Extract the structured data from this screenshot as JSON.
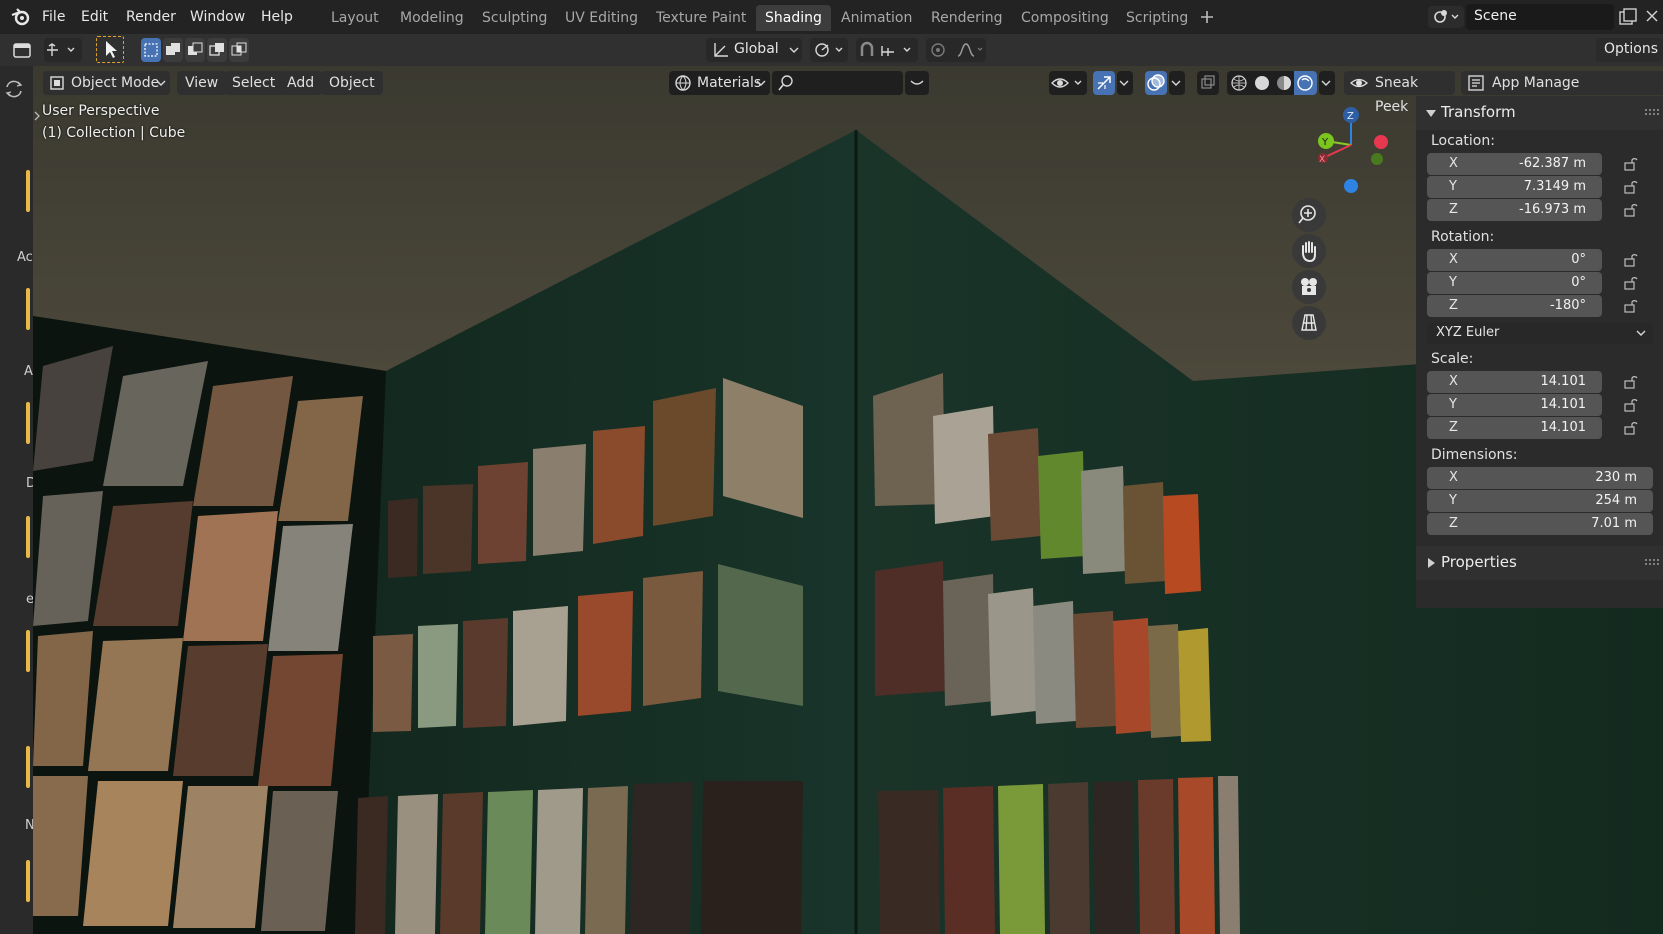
{
  "menu": {
    "items": [
      "File",
      "Edit",
      "Render",
      "Window",
      "Help"
    ]
  },
  "workspaces": [
    "Layout",
    "Modeling",
    "Sculpting",
    "UV Editing",
    "Texture Paint",
    "Shading",
    "Animation",
    "Rendering",
    "Compositing",
    "Scripting"
  ],
  "active_workspace": "Shading",
  "scene": {
    "name": "Scene"
  },
  "toolbar": {
    "orientation": "Global",
    "options_label": "Options"
  },
  "viewport_header": {
    "mode": "Object Mode",
    "view": "View",
    "select": "Select",
    "add": "Add",
    "object": "Object",
    "materials": "Materials",
    "search_value": "",
    "sneak_peek": "Sneak Peek",
    "app_manager": "App Manage"
  },
  "viewport": {
    "perspective": "User Perspective",
    "collection": "(1) Collection | Cube"
  },
  "left_strip_labels": [
    "Ac",
    "A",
    "D",
    "e",
    "N"
  ],
  "npanel": {
    "transform_title": "Transform",
    "properties_title": "Properties",
    "location_label": "Location:",
    "rotation_label": "Rotation:",
    "scale_label": "Scale:",
    "dimensions_label": "Dimensions:",
    "rotation_mode": "XYZ Euler",
    "location": [
      {
        "axis": "X",
        "value": "-62.387 m"
      },
      {
        "axis": "Y",
        "value": "7.3149 m"
      },
      {
        "axis": "Z",
        "value": "-16.973 m"
      }
    ],
    "rotation": [
      {
        "axis": "X",
        "value": "0°"
      },
      {
        "axis": "Y",
        "value": "0°"
      },
      {
        "axis": "Z",
        "value": "-180°"
      }
    ],
    "scale": [
      {
        "axis": "X",
        "value": "14.101"
      },
      {
        "axis": "Y",
        "value": "14.101"
      },
      {
        "axis": "Z",
        "value": "14.101"
      }
    ],
    "dimensions": [
      {
        "axis": "X",
        "value": "230 m"
      },
      {
        "axis": "Y",
        "value": "254 m"
      },
      {
        "axis": "Z",
        "value": "7.01 m"
      }
    ]
  },
  "gizmo": {
    "z_label": "Z",
    "y_label": "Y",
    "x_label": "X"
  },
  "colors": {
    "accent": "#4772b3",
    "axis_x": "#e8384f",
    "axis_y": "#8ac926",
    "axis_z": "#2f84e3"
  }
}
